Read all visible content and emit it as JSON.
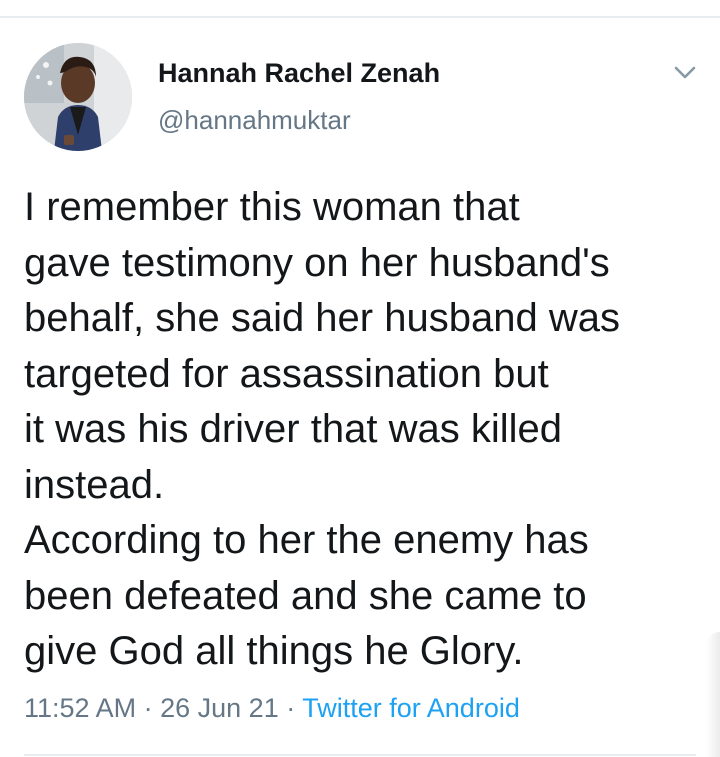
{
  "tweet": {
    "author": {
      "display_name": "Hannah Rachel Zenah",
      "handle": "@hannahmuktar"
    },
    "text_lines": [
      "I remember this woman that",
      "gave testimony on her husband's",
      "behalf, she said her husband was",
      "targeted for assassination but",
      "it was his driver that was killed",
      "instead.",
      "According to her the enemy has",
      "been defeated and she came to",
      "give God all things he Glory."
    ],
    "meta": {
      "time": "11:52 AM",
      "separator": "·",
      "date": "26 Jun 21",
      "source": "Twitter for Android"
    }
  },
  "icons": {
    "more": "chevron-down-icon"
  },
  "colors": {
    "text": "#14171a",
    "secondary": "#657786",
    "link": "#1da1f2",
    "divider": "#e6ecf0"
  }
}
